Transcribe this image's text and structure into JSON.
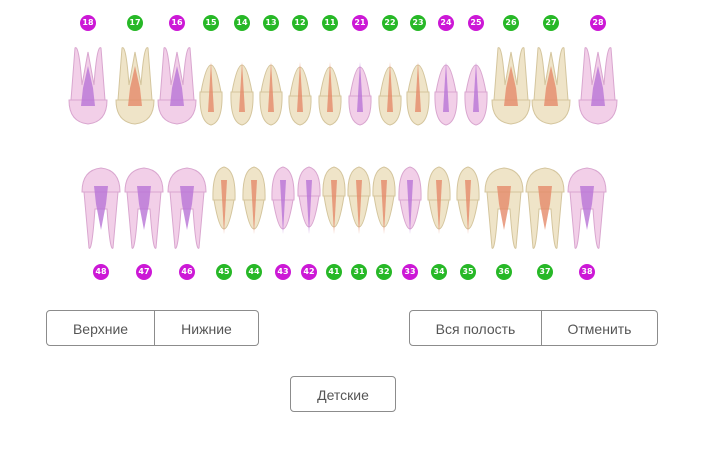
{
  "colors": {
    "primary_tooth": "#cc18d6",
    "permanent_tooth": "#27b827"
  },
  "upper_teeth": [
    {
      "num": "18",
      "kind": "primary",
      "type": "molar"
    },
    {
      "num": "17",
      "kind": "permanent",
      "type": "molar"
    },
    {
      "num": "16",
      "kind": "primary",
      "type": "molar"
    },
    {
      "num": "15",
      "kind": "permanent",
      "type": "premolar"
    },
    {
      "num": "14",
      "kind": "permanent",
      "type": "premolar"
    },
    {
      "num": "13",
      "kind": "permanent",
      "type": "canine"
    },
    {
      "num": "12",
      "kind": "permanent",
      "type": "incisor"
    },
    {
      "num": "11",
      "kind": "permanent",
      "type": "incisor"
    },
    {
      "num": "21",
      "kind": "primary",
      "type": "incisor"
    },
    {
      "num": "22",
      "kind": "permanent",
      "type": "incisor"
    },
    {
      "num": "23",
      "kind": "permanent",
      "type": "canine"
    },
    {
      "num": "24",
      "kind": "primary",
      "type": "premolar"
    },
    {
      "num": "25",
      "kind": "primary",
      "type": "premolar"
    },
    {
      "num": "26",
      "kind": "permanent",
      "type": "molar"
    },
    {
      "num": "27",
      "kind": "permanent",
      "type": "molar"
    },
    {
      "num": "28",
      "kind": "primary",
      "type": "molar"
    }
  ],
  "lower_teeth": [
    {
      "num": "48",
      "kind": "primary",
      "type": "molar"
    },
    {
      "num": "47",
      "kind": "primary",
      "type": "molar"
    },
    {
      "num": "46",
      "kind": "primary",
      "type": "molar"
    },
    {
      "num": "45",
      "kind": "permanent",
      "type": "premolar"
    },
    {
      "num": "44",
      "kind": "permanent",
      "type": "premolar"
    },
    {
      "num": "43",
      "kind": "primary",
      "type": "canine"
    },
    {
      "num": "42",
      "kind": "primary",
      "type": "incisor"
    },
    {
      "num": "41",
      "kind": "permanent",
      "type": "incisor"
    },
    {
      "num": "31",
      "kind": "permanent",
      "type": "incisor"
    },
    {
      "num": "32",
      "kind": "permanent",
      "type": "incisor"
    },
    {
      "num": "33",
      "kind": "primary",
      "type": "canine"
    },
    {
      "num": "34",
      "kind": "permanent",
      "type": "premolar"
    },
    {
      "num": "35",
      "kind": "permanent",
      "type": "premolar"
    },
    {
      "num": "36",
      "kind": "permanent",
      "type": "molar"
    },
    {
      "num": "37",
      "kind": "permanent",
      "type": "molar"
    },
    {
      "num": "38",
      "kind": "primary",
      "type": "molar"
    }
  ],
  "buttons": {
    "upper": "Верхние",
    "lower": "Нижние",
    "whole_cavity": "Вся полость",
    "cancel": "Отменить",
    "children": "Детские"
  }
}
